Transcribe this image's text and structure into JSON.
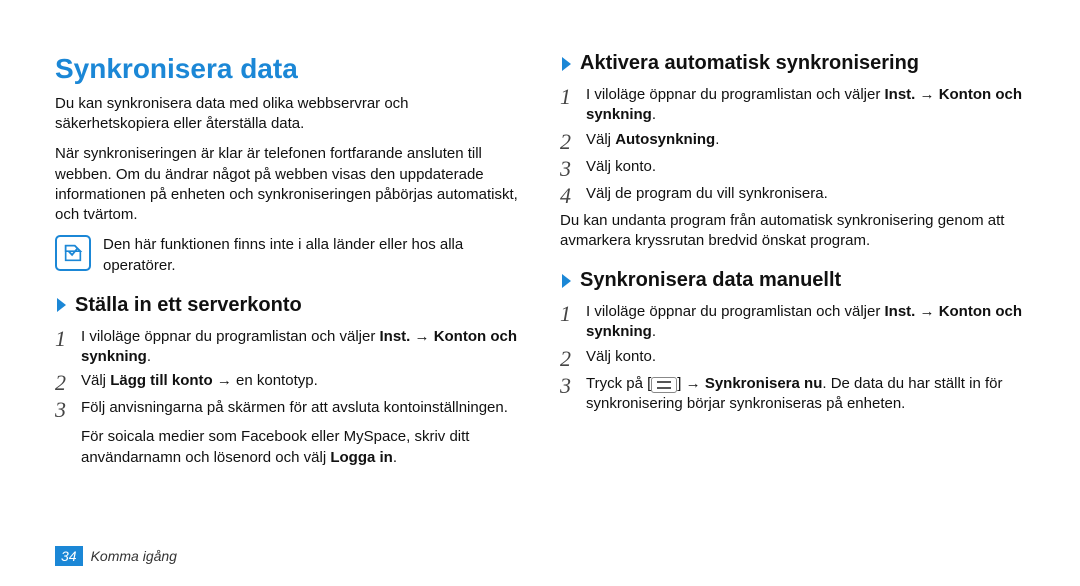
{
  "title": "Synkronisera data",
  "col1": {
    "intro1": "Du kan synkronisera data med olika webbservrar och säkerhetskopiera eller återställa data.",
    "intro2": "När synkroniseringen är klar är telefonen fortfarande ansluten till webben. Om du ändrar något på webben visas den uppdaterade informationen på enheten och synkroniseringen påbörjas automatiskt, och tvärtom.",
    "note": "Den här funktionen finns inte i alla länder eller hos alla operatörer.",
    "sec1": {
      "heading": "Ställa in ett serverkonto",
      "steps": [
        {
          "pre": "I viloläge öppnar du programlistan och väljer ",
          "b1": "Inst.",
          "mid": " → ",
          "b2": "Konton och synkning",
          "post": "."
        },
        {
          "pre": "Välj ",
          "b1": "Lägg till konto",
          "mid": " → en kontotyp.",
          "b2": "",
          "post": ""
        },
        {
          "pre": "Följ anvisningarna på skärmen för att avsluta kontoinställningen.",
          "b1": "",
          "mid": "",
          "b2": "",
          "post": ""
        }
      ],
      "subnote_pre": "För soicala medier som Facebook eller MySpace, skriv ditt användarnamn och lösenord och välj ",
      "subnote_bold": "Logga in",
      "subnote_post": "."
    }
  },
  "col2": {
    "sec2": {
      "heading": "Aktivera automatisk synkronisering",
      "steps": [
        {
          "pre": "I viloläge öppnar du programlistan och väljer ",
          "b1": "Inst.",
          "mid": " → ",
          "b2": "Konton och synkning",
          "post": "."
        },
        {
          "pre": "Välj ",
          "b1": "Autosynkning",
          "mid": ".",
          "b2": "",
          "post": ""
        },
        {
          "pre": "Välj konto.",
          "b1": "",
          "mid": "",
          "b2": "",
          "post": ""
        },
        {
          "pre": "Välj de program du vill synkronisera.",
          "b1": "",
          "mid": "",
          "b2": "",
          "post": ""
        }
      ],
      "after": "Du kan undanta program från automatisk synkronisering genom att avmarkera kryssrutan bredvid önskat program."
    },
    "sec3": {
      "heading": "Synkronisera data manuellt",
      "steps": [
        {
          "pre": "I viloläge öppnar du programlistan och väljer ",
          "b1": "Inst.",
          "mid": " → ",
          "b2": "Konton och synkning",
          "post": "."
        },
        {
          "pre": "Välj konto.",
          "b1": "",
          "mid": "",
          "b2": "",
          "post": ""
        },
        {
          "pre": "Tryck på [",
          "icon": true,
          "mid": "] → ",
          "b1": "Synkronisera nu",
          "post": ". De data du har ställt in för synkronisering börjar synkroniseras på enheten."
        }
      ]
    }
  },
  "footer": {
    "page": "34",
    "section": "Komma igång"
  }
}
